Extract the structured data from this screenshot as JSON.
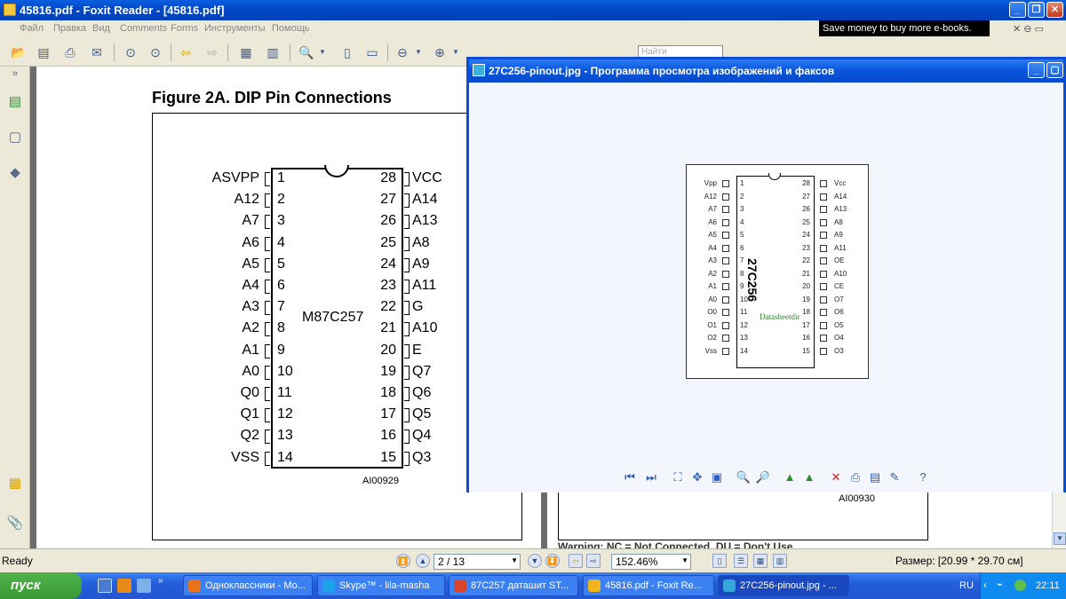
{
  "main_window": {
    "title": "45816.pdf - Foxit Reader - [45816.pdf]",
    "menu": [
      "Файл",
      "Правка",
      "Вид",
      "Comments",
      "Forms",
      "Инструменты",
      "Помощь"
    ],
    "ad_text": "Save money to buy more e-books.",
    "find_placeholder": "Найти"
  },
  "pdf": {
    "figure_title": "Figure 2A. DIP Pin Connections",
    "chip_name": "M87C257",
    "figure_ref": "AI00929",
    "figure_ref2": "AI00930",
    "cut_text": "Warning: NC = Not Connected, DU = Don't Use",
    "left_pins": [
      {
        "n": "1",
        "label": "ASVPP"
      },
      {
        "n": "2",
        "label": "A12"
      },
      {
        "n": "3",
        "label": "A7"
      },
      {
        "n": "4",
        "label": "A6"
      },
      {
        "n": "5",
        "label": "A5"
      },
      {
        "n": "6",
        "label": "A4"
      },
      {
        "n": "7",
        "label": "A3"
      },
      {
        "n": "8",
        "label": "A2"
      },
      {
        "n": "9",
        "label": "A1"
      },
      {
        "n": "10",
        "label": "A0"
      },
      {
        "n": "11",
        "label": "Q0"
      },
      {
        "n": "12",
        "label": "Q1"
      },
      {
        "n": "13",
        "label": "Q2"
      },
      {
        "n": "14",
        "label": "VSS"
      }
    ],
    "right_pins": [
      {
        "n": "28",
        "label": "VCC"
      },
      {
        "n": "27",
        "label": "A14"
      },
      {
        "n": "26",
        "label": "A13"
      },
      {
        "n": "25",
        "label": "A8"
      },
      {
        "n": "24",
        "label": "A9"
      },
      {
        "n": "23",
        "label": "A11"
      },
      {
        "n": "22",
        "label": "G"
      },
      {
        "n": "21",
        "label": "A10"
      },
      {
        "n": "20",
        "label": "E"
      },
      {
        "n": "19",
        "label": "Q7"
      },
      {
        "n": "18",
        "label": "Q6"
      },
      {
        "n": "17",
        "label": "Q5"
      },
      {
        "n": "16",
        "label": "Q4"
      },
      {
        "n": "15",
        "label": "Q3"
      }
    ]
  },
  "viewer": {
    "title": "27C256-pinout.jpg - Программа просмотра изображений и факсов",
    "chip_name": "27C256",
    "watermark": "Datasheetdir",
    "left_pins": [
      {
        "n": "1",
        "label": "Vpp"
      },
      {
        "n": "2",
        "label": "A12"
      },
      {
        "n": "3",
        "label": "A7"
      },
      {
        "n": "4",
        "label": "A6"
      },
      {
        "n": "5",
        "label": "A5"
      },
      {
        "n": "6",
        "label": "A4"
      },
      {
        "n": "7",
        "label": "A3"
      },
      {
        "n": "8",
        "label": "A2"
      },
      {
        "n": "9",
        "label": "A1"
      },
      {
        "n": "10",
        "label": "A0"
      },
      {
        "n": "11",
        "label": "O0"
      },
      {
        "n": "12",
        "label": "O1"
      },
      {
        "n": "13",
        "label": "O2"
      },
      {
        "n": "14",
        "label": "Vss"
      }
    ],
    "right_pins": [
      {
        "n": "28",
        "label": "Vcc"
      },
      {
        "n": "27",
        "label": "A14"
      },
      {
        "n": "26",
        "label": "A13"
      },
      {
        "n": "25",
        "label": "A8"
      },
      {
        "n": "24",
        "label": "A9"
      },
      {
        "n": "23",
        "label": "A11"
      },
      {
        "n": "22",
        "label": "OE"
      },
      {
        "n": "21",
        "label": "A10"
      },
      {
        "n": "20",
        "label": "CE"
      },
      {
        "n": "19",
        "label": "O7"
      },
      {
        "n": "18",
        "label": "O6"
      },
      {
        "n": "17",
        "label": "O5"
      },
      {
        "n": "16",
        "label": "O4"
      },
      {
        "n": "15",
        "label": "O3"
      }
    ]
  },
  "status": {
    "ready": "Ready",
    "page": "2 / 13",
    "zoom": "152.46%",
    "size": "Размер: [20.99 * 29.70 см]"
  },
  "taskbar": {
    "start": "пуск",
    "tasks": [
      {
        "label": "Одноклассники - Мо...",
        "color": "#e8731a"
      },
      {
        "label": "Skype™ - lila-masha",
        "color": "#1aa3e8"
      },
      {
        "label": "87C257 даташит ST...",
        "color": "#d9442c"
      },
      {
        "label": "45816.pdf - Foxit Re...",
        "color": "#f2b41d"
      },
      {
        "label": "27C256-pinout.jpg - ...",
        "color": "#35a7d8"
      }
    ],
    "lang": "RU",
    "clock": "22:11"
  }
}
